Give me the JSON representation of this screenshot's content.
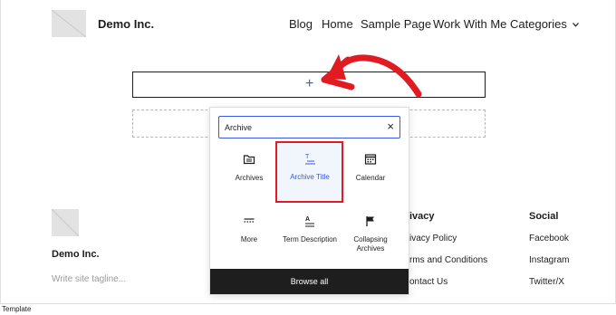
{
  "header": {
    "site_title": "Demo Inc.",
    "nav": [
      "Blog",
      "Home",
      "Sample Page",
      "Work With Me",
      "Categories"
    ]
  },
  "editor": {
    "append_symbol": "+"
  },
  "inserter": {
    "search_value": "Archive",
    "clear_symbol": "×",
    "blocks": [
      {
        "label": "Archives",
        "icon": "folder-icon"
      },
      {
        "label": "Archive Title",
        "icon": "title-icon",
        "selected": true
      },
      {
        "label": "Calendar",
        "icon": "calendar-icon"
      },
      {
        "label": "More",
        "icon": "more-icon"
      },
      {
        "label": "Term Description",
        "icon": "term-description-icon"
      },
      {
        "label": "Collapsing Archives",
        "icon": "flag-icon"
      }
    ],
    "browse_all": "Browse all"
  },
  "footer": {
    "site_title": "Demo Inc.",
    "tagline": "Write site tagline...",
    "col_heading": "ivacy",
    "col_links": [
      "ivacy Policy",
      "rms and Conditions",
      "ontact Us"
    ],
    "social_heading": "Social",
    "social_links": [
      "Facebook",
      "Instagram",
      "Twitter/X"
    ]
  },
  "status": {
    "breadcrumb": "Template"
  },
  "colors": {
    "accent": "#3858e9",
    "annotation": "#e21b23",
    "dark": "#1e1e1e"
  }
}
